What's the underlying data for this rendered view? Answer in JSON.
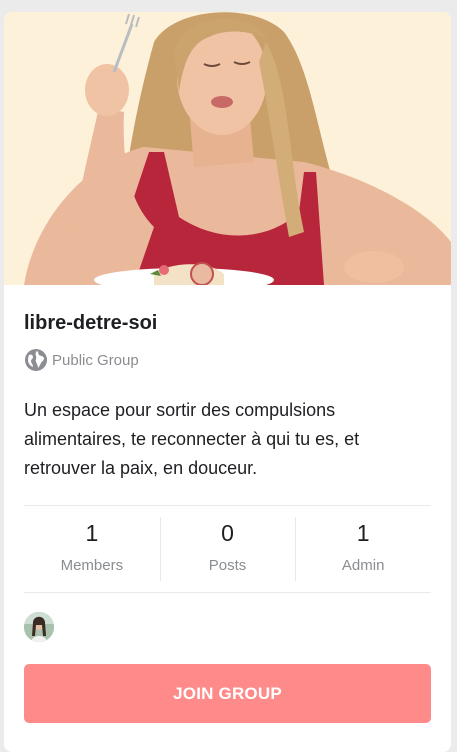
{
  "group": {
    "title": "libre-detre-soi",
    "privacy_label": "Public Group",
    "privacy_icon": "globe-icon",
    "cover_image": "woman-eating-cake-photo",
    "description": "Un espace pour sortir des compulsions alimentaires, te reconnecter à qui tu es, et retrouver la paix, en douceur.",
    "stats": [
      {
        "count": "1",
        "label": "Members"
      },
      {
        "count": "0",
        "label": "Posts"
      },
      {
        "count": "1",
        "label": "Admin"
      }
    ],
    "member_avatars": [
      "member-avatar"
    ],
    "join_button": {
      "label": "JOIN GROUP",
      "color": "#ff8a8a"
    }
  }
}
